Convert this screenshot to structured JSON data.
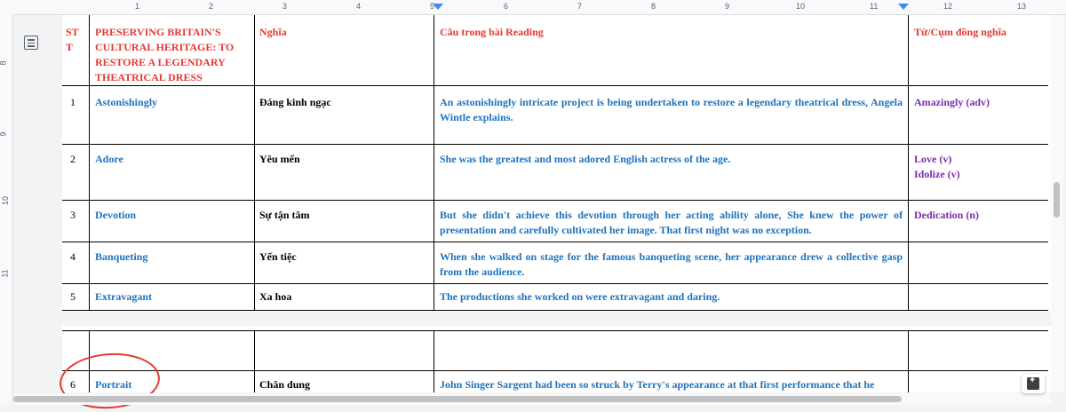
{
  "ruler": {
    "numbers": [
      "1",
      "2",
      "3",
      "4",
      "5",
      "6",
      "7",
      "8",
      "9",
      "10",
      "11",
      "12",
      "13"
    ],
    "left_numbers": [
      "8",
      "9",
      "10",
      "11"
    ]
  },
  "table": {
    "headers": {
      "stt": "ST T",
      "word": "PRESERVING BRITAIN'S CULTURAL HERITAGE: TO RESTORE A LEGENDARY THEATRICAL DRESS",
      "meaning": "Nghĩa",
      "sentence": "Câu trong bài Reading",
      "synonym": "Từ/Cụm  đồng nghĩa"
    },
    "rows": [
      {
        "stt": "1",
        "word": "Astonishingly",
        "meaning": "Đáng kinh ngạc",
        "sentence": "An astonishingly intricate project is being undertaken to restore a legendary theatrical dress, Angela Wintle explains.",
        "synonym": "Amazingly (adv)"
      },
      {
        "stt": "2",
        "word": "Adore",
        "meaning": "Yêu mến",
        "sentence": "She was the greatest and most adored English actress of the age.",
        "synonym": "Love (v)\nIdolize (v)"
      },
      {
        "stt": "3",
        "word": "Devotion",
        "meaning": "Sự tận tâm",
        "sentence": "But she didn't achieve this devotion through her acting ability alone, She knew the power of presentation and carefully cultivated her image. That first night was no exception.",
        "synonym": "Dedication (n)"
      },
      {
        "stt": "4",
        "word": "Banqueting",
        "meaning": "Yến tiệc",
        "sentence": "When she walked on stage for the famous banqueting scene, her appearance drew a collective gasp from the audience.",
        "synonym": ""
      },
      {
        "stt": "5",
        "word": "Extravagant",
        "meaning": "Xa hoa",
        "sentence": "The productions she worked on were extravagant and daring.",
        "synonym": ""
      },
      {
        "stt": "6",
        "word": "Portrait",
        "meaning": "Chân dung",
        "sentence": "John Singer Sargent had been so struck by Terry's appearance at that first performance that he",
        "synonym": ""
      }
    ]
  },
  "colors": {
    "header_red": "#e53935",
    "word_blue": "#1e73be",
    "synonym_purple": "#7b2cad",
    "annotation_circle": "#e53935"
  },
  "icons": {
    "outline": "document-outline-icon",
    "explore": "explore-icon"
  }
}
